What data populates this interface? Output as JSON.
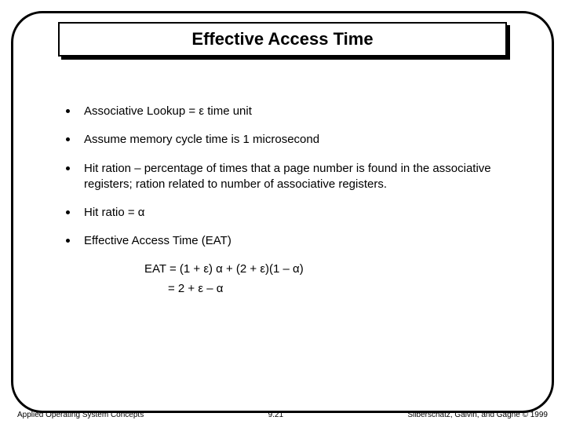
{
  "title": "Effective Access Time",
  "bullets": [
    "Associative Lookup = ε time unit",
    "Assume memory cycle time is 1 microsecond",
    "Hit ration – percentage of times that a page number is found in the associative registers; ration related to number of associative registers.",
    "Hit ratio = α",
    "Effective Access Time (EAT)"
  ],
  "equations": {
    "line1": "EAT = (1 + ε) α + (2 + ε)(1 – α)",
    "line2": "= 2 + ε – α"
  },
  "footer": {
    "left": "Applied Operating System Concepts",
    "center": "9.21",
    "right": "Silberschatz, Galvin, and Gagne © 1999"
  }
}
